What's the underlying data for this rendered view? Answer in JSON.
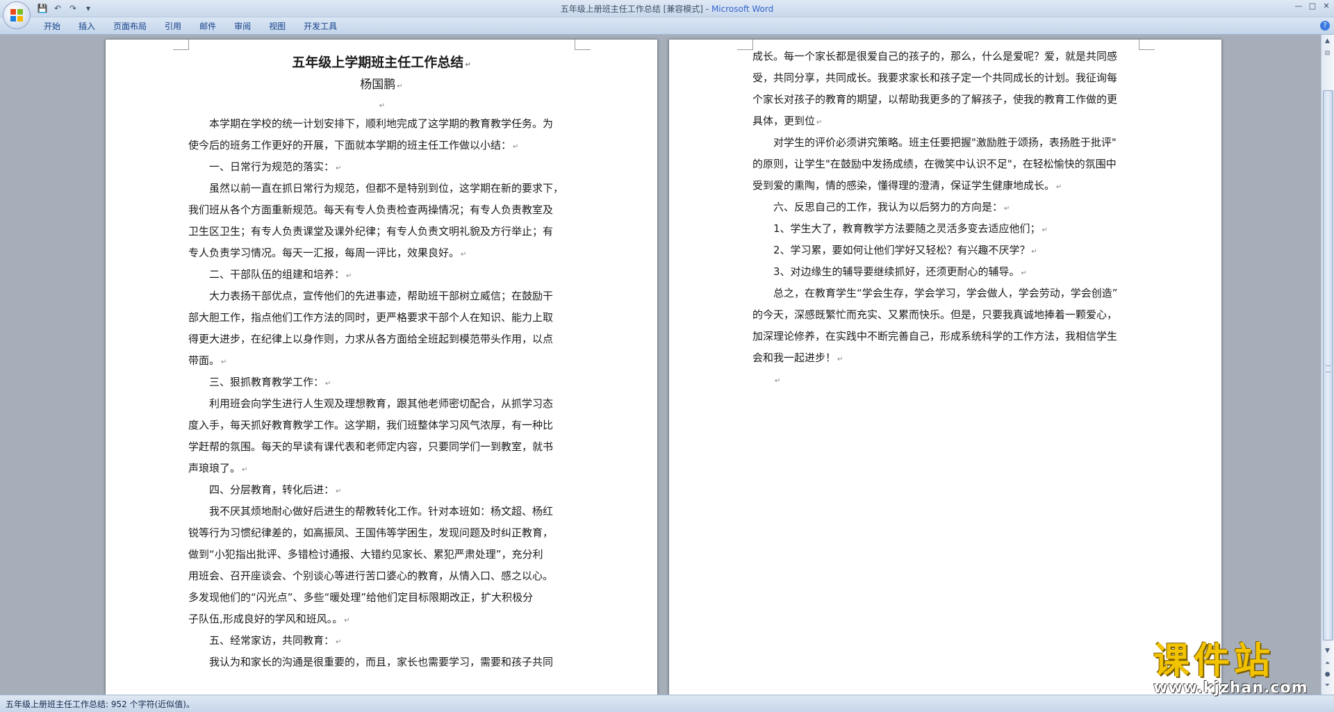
{
  "window": {
    "title": "五年级上册班主任工作总结 [兼容模式]",
    "separator": " - ",
    "app_name": "Microsoft Word",
    "controls": [
      "—",
      "□",
      "✕"
    ]
  },
  "quick_access": {
    "save_icon": "💾",
    "undo_icon": "↶",
    "redo_icon": "↷",
    "customize_icon": "▾"
  },
  "ribbon": {
    "tabs": [
      "开始",
      "插入",
      "页面布局",
      "引用",
      "邮件",
      "审阅",
      "视图",
      "开发工具"
    ],
    "help_icon": "?"
  },
  "document": {
    "left_page": {
      "title": "五年级上学期班主任工作总结",
      "author": "杨国鹏",
      "lines": [
        {
          "text": "本学期在学校的统一计划安排下，顺利地完成了这学期的教育教学任务。为",
          "indent": true,
          "pm": false
        },
        {
          "text": "使今后的班务工作更好的开展，下面就本学期的班主任工作做以小结：",
          "indent": false,
          "pm": true
        },
        {
          "text": "一、日常行为规范的落实：",
          "indent": true,
          "pm": true
        },
        {
          "text": "虽然以前一直在抓日常行为规范，但都不是特别到位，这学期在新的要求下，",
          "indent": true,
          "pm": false
        },
        {
          "text": "我们班从各个方面重新规范。每天有专人负责检查两操情况；有专人负责教室及",
          "indent": false,
          "pm": false
        },
        {
          "text": "卫生区卫生；有专人负责课堂及课外纪律；有专人负责文明礼貌及方行举止；有",
          "indent": false,
          "pm": false
        },
        {
          "text": "专人负责学习情况。每天一汇报，每周一评比，效果良好。",
          "indent": false,
          "pm": true
        },
        {
          "text": "二、干部队伍的组建和培养：",
          "indent": true,
          "pm": true
        },
        {
          "text": "大力表扬干部优点，宣传他们的先进事迹，帮助班干部树立威信；在鼓励干",
          "indent": true,
          "pm": false
        },
        {
          "text": "部大胆工作，指点他们工作方法的同时，更严格要求干部个人在知识、能力上取",
          "indent": false,
          "pm": false
        },
        {
          "text": "得更大进步，在纪律上以身作则，力求从各方面给全班起到模范带头作用，以点",
          "indent": false,
          "pm": false
        },
        {
          "text": "带面。",
          "indent": false,
          "pm": true
        },
        {
          "text": "三、狠抓教育教学工作：",
          "indent": true,
          "pm": true
        },
        {
          "text": "利用班会向学生进行人生观及理想教育，跟其他老师密切配合，从抓学习态",
          "indent": true,
          "pm": false
        },
        {
          "text": "度入手，每天抓好教育教学工作。这学期，我们班整体学习风气浓厚，有一种比",
          "indent": false,
          "pm": false
        },
        {
          "text": "学赶帮的氛围。每天的早读有课代表和老师定内容，只要同学们一到教室，就书",
          "indent": false,
          "pm": false
        },
        {
          "text": "声琅琅了。",
          "indent": false,
          "pm": true
        },
        {
          "text": "四、分层教育，转化后进：",
          "indent": true,
          "pm": true
        },
        {
          "text": "我不厌其烦地耐心做好后进生的帮教转化工作。针对本班如：杨文超、杨红",
          "indent": true,
          "pm": false
        },
        {
          "text": "锐等行为习惯纪律差的，如高振凤、王国伟等学困生，发现问题及时纠正教育，",
          "indent": false,
          "pm": false
        },
        {
          "text": "做到“小犯指出批评、多错检讨通报、大错约见家长、累犯严肃处理”，充分利",
          "indent": false,
          "pm": false
        },
        {
          "text": "用班会、召开座谈会、个别谈心等进行苦口婆心的教育，从情入口、感之以心。",
          "indent": false,
          "pm": false
        },
        {
          "text": "多发现他们的“闪光点”、多些“暖处理”给他们定目标限期改正，扩大积极分",
          "indent": false,
          "pm": false
        },
        {
          "text": "子队伍,形成良好的学风和班风。。",
          "indent": false,
          "pm": true
        },
        {
          "text": "五、经常家访，共同教育：",
          "indent": true,
          "pm": true
        },
        {
          "text": "我认为和家长的沟通是很重要的，而且，家长也需要学习，需要和孩子共同",
          "indent": true,
          "pm": false
        }
      ]
    },
    "right_page": {
      "lines": [
        {
          "text": "成长。每一个家长都是很爱自己的孩子的，那么，什么是爱呢？爱，就是共同感",
          "indent": false,
          "pm": false
        },
        {
          "text": "受，共同分享，共同成长。我要求家长和孩子定一个共同成长的计划。我征询每",
          "indent": false,
          "pm": false
        },
        {
          "text": "个家长对孩子的教育的期望，以帮助我更多的了解孩子，使我的教育工作做的更",
          "indent": false,
          "pm": false
        },
        {
          "text": "具体，更到位",
          "indent": false,
          "pm": true
        },
        {
          "text": "对学生的评价必须讲究策略。班主任要把握\"激励胜于颂扬，表扬胜于批评\"",
          "indent": true,
          "pm": false
        },
        {
          "text": "的原则，让学生\"在鼓励中发扬成绩，在微笑中认识不足\"，在轻松愉快的氛围中",
          "indent": false,
          "pm": false
        },
        {
          "text": "受到爱的熏陶，情的感染，懂得理的澄清，保证学生健康地成长。",
          "indent": false,
          "pm": true
        },
        {
          "text": "六、反思自己的工作，我认为以后努力的方向是：",
          "indent": true,
          "pm": true
        },
        {
          "text": "1、学生大了，教育教学方法要随之灵活多变去适应他们；",
          "indent": true,
          "pm": true
        },
        {
          "text": "2、学习累，要如何让他们学好又轻松？有兴趣不厌学？",
          "indent": true,
          "pm": true
        },
        {
          "text": "3、对边缘生的辅导要继续抓好，还须更耐心的辅导。",
          "indent": true,
          "pm": true
        },
        {
          "text": "总之，在教育学生“学会生存，学会学习，学会做人，学会劳动，学会创造”",
          "indent": true,
          "pm": false
        },
        {
          "text": "的今天，深感既繁忙而充实、又累而快乐。但是，只要我真诚地捧着一颗爱心，",
          "indent": false,
          "pm": false
        },
        {
          "text": "加深理论修养，在实践中不断完善自己，形成系统科学的工作方法，我相信学生",
          "indent": false,
          "pm": false
        },
        {
          "text": "会和我一起进步！",
          "indent": false,
          "pm": true
        },
        {
          "text": "",
          "indent": true,
          "pm": true
        }
      ]
    },
    "paragraph_mark": "↵"
  },
  "statusbar": {
    "text": "五年级上册班主任工作总结: 952 个字符(近似值)。"
  },
  "watermark": {
    "main": "课件站",
    "url": "www.kjzhan.com"
  },
  "colors": {
    "ribbon_text": "#15428b",
    "app_name": "#3366cc",
    "watermark": "#f2c300"
  }
}
